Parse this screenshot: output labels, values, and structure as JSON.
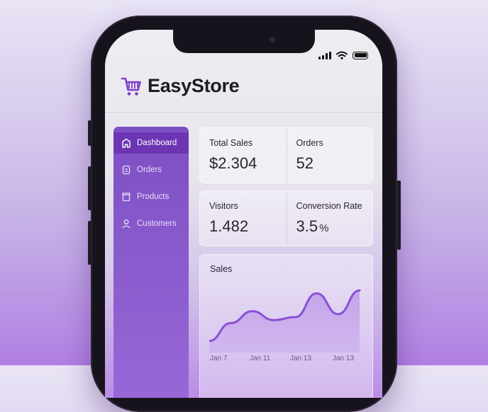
{
  "app": {
    "name": "EasyStore",
    "logo_icon": "shopping-cart-icon",
    "accent": "#7a3fc8"
  },
  "status_bar": {
    "signal_icon": "signal-icon",
    "wifi_icon": "wifi-icon",
    "battery_icon": "battery-icon"
  },
  "sidebar": {
    "items": [
      {
        "label": "Dashboard",
        "icon": "home-icon",
        "active": true
      },
      {
        "label": "Orders",
        "icon": "document-icon",
        "active": false
      },
      {
        "label": "Products",
        "icon": "box-icon",
        "active": false
      },
      {
        "label": "Customers",
        "icon": "user-icon",
        "active": false
      }
    ]
  },
  "stats": {
    "total_sales": {
      "label": "Total Sales",
      "value": "$2.304"
    },
    "orders": {
      "label": "Orders",
      "value": "52"
    },
    "visitors": {
      "label": "Visitors",
      "value": "1.482"
    },
    "conversion_rate": {
      "label": "Conversion Rate",
      "value": "3.5",
      "unit": "%"
    }
  },
  "chart_data": {
    "type": "area",
    "title": "Sales",
    "x": [
      "Jan 7",
      "",
      "Jan 11",
      "",
      "Jan 13",
      "",
      "Jan 13",
      ""
    ],
    "values": [
      0.1,
      0.4,
      0.6,
      0.45,
      0.5,
      0.9,
      0.55,
      0.95
    ],
    "ylim": [
      0,
      1
    ],
    "tick_labels": [
      "Jan 7",
      "Jan 11",
      "Jan 13",
      "Jan 13"
    ],
    "line_color": "#8b4fd6",
    "grid": false
  }
}
